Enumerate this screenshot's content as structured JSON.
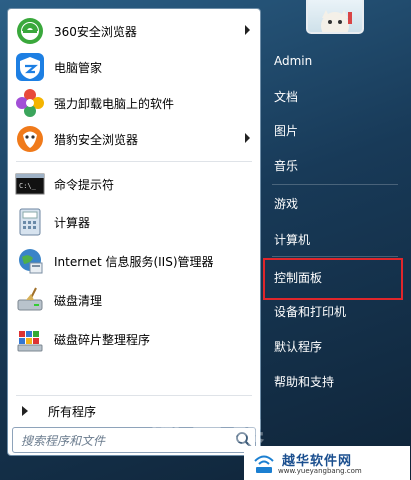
{
  "pinned_items": [
    {
      "label": "360安全浏览器",
      "icon": "360-browser-icon",
      "has_submenu": true
    },
    {
      "label": "电脑管家",
      "icon": "tencent-pc-manager-icon",
      "has_submenu": false
    },
    {
      "label": "强力卸载电脑上的软件",
      "icon": "uninstaller-icon",
      "has_submenu": false
    },
    {
      "label": "猎豹安全浏览器",
      "icon": "liebao-browser-icon",
      "has_submenu": true
    }
  ],
  "recent_items": [
    {
      "label": "命令提示符",
      "icon": "command-prompt-icon",
      "has_submenu": false
    },
    {
      "label": "计算器",
      "icon": "calculator-icon",
      "has_submenu": false
    },
    {
      "label": "Internet 信息服务(IIS)管理器",
      "icon": "iis-manager-icon",
      "has_submenu": false
    },
    {
      "label": "磁盘清理",
      "icon": "disk-cleanup-icon",
      "has_submenu": false
    },
    {
      "label": "磁盘碎片整理程序",
      "icon": "disk-defrag-icon",
      "has_submenu": false
    }
  ],
  "all_programs": "所有程序",
  "search": {
    "placeholder": "搜索程序和文件"
  },
  "right_items": [
    {
      "label": "Admin"
    },
    {
      "label": "文档"
    },
    {
      "label": "图片"
    },
    {
      "label": "音乐"
    },
    {
      "label": "游戏"
    },
    {
      "label": "计算机"
    },
    {
      "label": "控制面板"
    },
    {
      "label": "设备和打印机"
    },
    {
      "label": "默认程序"
    },
    {
      "label": "帮助和支持"
    }
  ],
  "highlighted_item": "控制面板",
  "watermark": {
    "title": "越华软件网",
    "url": "www.yueyangbang.com",
    "overlay": "路由器"
  },
  "colors": {
    "highlight_border": "#e0262b",
    "panel_bg": "#1d3c5a"
  }
}
